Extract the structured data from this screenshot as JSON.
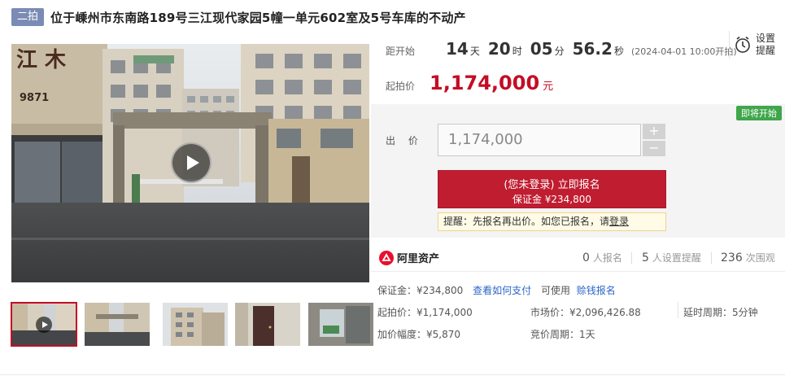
{
  "header": {
    "round_badge": "二拍",
    "title": "位于嵊州市东南路189号三江现代家园5幢一单元602室及5号车库的不动产"
  },
  "gallery": {
    "sign_text_top": "江 木",
    "sign_text_num": "9871",
    "thumbnails": [
      {
        "label": "video",
        "active": true
      },
      {
        "label": "gate",
        "active": false
      },
      {
        "label": "building",
        "active": false
      },
      {
        "label": "door",
        "active": false
      },
      {
        "label": "window",
        "active": false
      }
    ]
  },
  "countdown": {
    "label": "距开始",
    "days": "14",
    "days_unit": "天",
    "hours": "20",
    "hours_unit": "时",
    "minutes": "05",
    "minutes_unit": "分",
    "seconds": "56.2",
    "seconds_unit": "秒",
    "start_time": "(2024-04-01 10:00开拍)"
  },
  "reminder": {
    "label_line1": "设置",
    "label_line2": "提醒"
  },
  "start_price": {
    "label": "起拍价",
    "value": "1,174,000",
    "unit": "元"
  },
  "bid": {
    "status_tag": "即将开始",
    "label": "出 价",
    "input_value": "1,174,000",
    "plus": "+",
    "minus": "−",
    "register_main": "(您未登录) 立即报名",
    "register_sub": "保证金 ¥234,800",
    "tip_text": "提醒：先报名再出价。如您已报名，请",
    "tip_link": "登录"
  },
  "stats": {
    "brand": "阿里资产",
    "registered_num": "0",
    "registered_label": "人报名",
    "reminder_num": "5",
    "reminder_label": "人设置提醒",
    "viewers_num": "236",
    "viewers_label": "次围观"
  },
  "deposit": {
    "text": "保证金：¥234,800",
    "link": "查看如何支付",
    "usable": "可使用",
    "usable_link": "赊钱报名"
  },
  "info": {
    "start_price": "起拍价：¥1,174,000",
    "market_price": "市场价：¥2,096,426.88",
    "delay_period": "延时周期：5分钟",
    "increment": "加价幅度：¥5,870",
    "bid_period": "竞价周期：1天"
  },
  "colors": {
    "accent_red": "#c40d25",
    "badge_blue": "#7a8bb5",
    "tag_green": "#3fa64a",
    "link_blue": "#2d66c7"
  }
}
